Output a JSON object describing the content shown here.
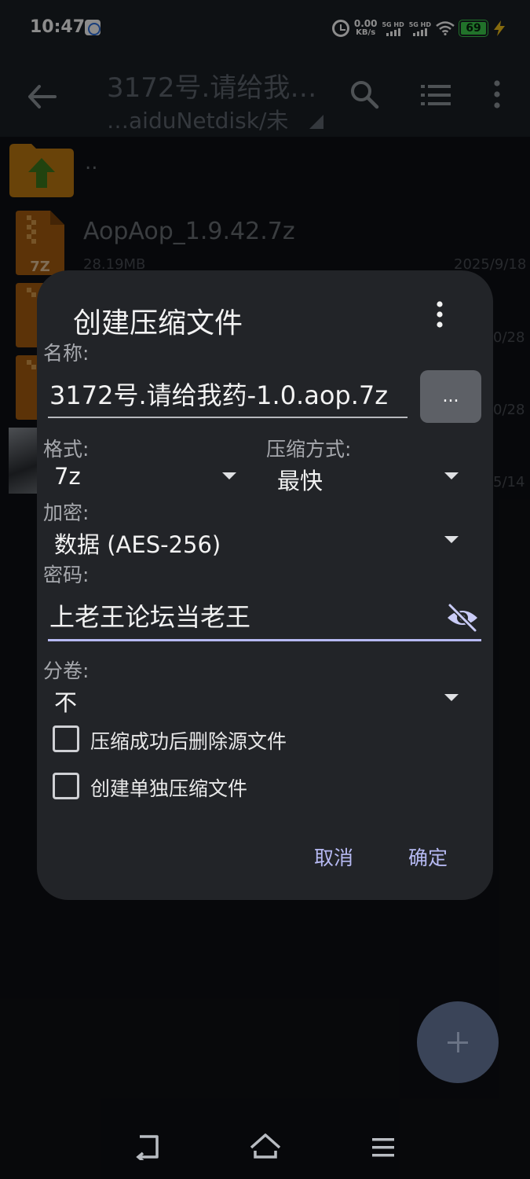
{
  "status_bar": {
    "time": "10:47",
    "net_speed_value": "0.00",
    "net_speed_unit": "KB/s",
    "sim1_label": "5G HD",
    "sim2_label": "5G HD",
    "battery": "69"
  },
  "app_bar": {
    "title": "3172号.请给我…",
    "subtitle": "…aiduNetdisk/未"
  },
  "files": {
    "parent_label": "..",
    "items": [
      {
        "name": "AopAop_1.9.42.7z",
        "size": "28.19MB",
        "date": "2025/9/18"
      },
      {
        "date_partial": "0/28"
      },
      {
        "date_partial": "0/28"
      },
      {
        "date_partial": "5/14"
      }
    ],
    "zip_badge": "7Z"
  },
  "dialog": {
    "title": "创建压缩文件",
    "name_label": "名称:",
    "name_value": "3172号.请给我药-1.0.aop.7z",
    "browse_label": "...",
    "format_label": "格式:",
    "format_value": "7z",
    "method_label": "压缩方式:",
    "method_value": "最快",
    "encryption_label": "加密:",
    "encryption_value": "数据 (AES-256)",
    "password_label": "密码:",
    "password_value": "上老王论坛当老王",
    "split_label": "分卷:",
    "split_value": "不",
    "delete_source_label": "压缩成功后删除源文件",
    "separate_archives_label": "创建单独压缩文件",
    "cancel_label": "取消",
    "ok_label": "确定"
  }
}
